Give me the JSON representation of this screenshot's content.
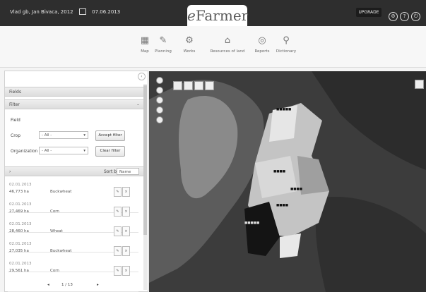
{
  "header": {
    "user_text": "Vlad gb, Jan Bivaca, 2012",
    "date_text": "07.06.2013",
    "logo_prefix": "e",
    "logo_rest": "Farmer",
    "upgrade_label": "UPGRADE"
  },
  "toolbar": {
    "items": [
      {
        "label": "Map",
        "icon": "map-icon"
      },
      {
        "label": "Planning",
        "icon": "planning-icon"
      },
      {
        "label": "Works",
        "icon": "works-icon"
      },
      {
        "label": "Resources of land",
        "icon": "home-icon"
      },
      {
        "label": "Reports",
        "icon": "reports-icon"
      },
      {
        "label": "Dictionary",
        "icon": "dictionary-icon"
      }
    ]
  },
  "panel": {
    "section_title": "Fields",
    "filter_title": "Filter",
    "field_label": "Field",
    "crop_label": "Crop",
    "crop_value": "- All -",
    "org_label": "Organization",
    "org_value": "- All -",
    "accept_label": "Accept filter",
    "clear_label": "Clear filter",
    "sort_label": "Sort by",
    "sort_value": "Name",
    "items": [
      {
        "date": "02.01.2013",
        "area": "46,773 ha",
        "crop": "Buckwheat"
      },
      {
        "date": "02.01.2013",
        "area": "27,469 ha",
        "crop": "Corn"
      },
      {
        "date": "02.01.2013",
        "area": "28,460 ha",
        "crop": "Wheat"
      },
      {
        "date": "02.01.2013",
        "area": "27,035 ha",
        "crop": "Buckwheat"
      },
      {
        "date": "02.01.2013",
        "area": "29,561 ha",
        "crop": "Corn"
      }
    ],
    "pager_text": "1 / 13"
  }
}
